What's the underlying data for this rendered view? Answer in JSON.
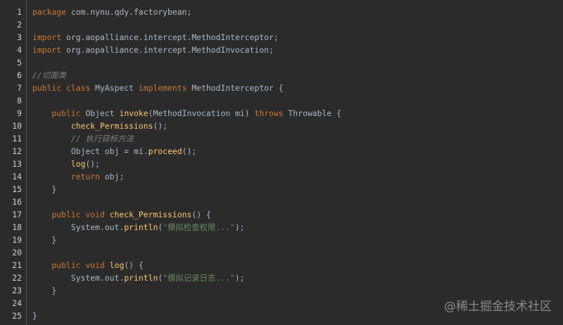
{
  "watermark": "@稀土掘金技术社区",
  "lines": [
    {
      "n": "1",
      "tokens": [
        {
          "c": "kw",
          "t": "package"
        },
        {
          "c": "plain",
          "t": " com.nynu.qdy.factorybean;"
        }
      ]
    },
    {
      "n": "2",
      "tokens": []
    },
    {
      "n": "3",
      "tokens": [
        {
          "c": "kw",
          "t": "import"
        },
        {
          "c": "plain",
          "t": " org.aopalliance.intercept.MethodInterceptor;"
        }
      ]
    },
    {
      "n": "4",
      "tokens": [
        {
          "c": "kw",
          "t": "import"
        },
        {
          "c": "plain",
          "t": " org.aopalliance.intercept.MethodInvocation;"
        }
      ]
    },
    {
      "n": "5",
      "tokens": []
    },
    {
      "n": "6",
      "tokens": [
        {
          "c": "cm-gray",
          "t": "//切面类"
        }
      ]
    },
    {
      "n": "7",
      "tokens": [
        {
          "c": "kw",
          "t": "public"
        },
        {
          "c": "plain",
          "t": " "
        },
        {
          "c": "kw",
          "t": "class"
        },
        {
          "c": "plain",
          "t": " MyAspect "
        },
        {
          "c": "kw",
          "t": "implements"
        },
        {
          "c": "plain",
          "t": " MethodInterceptor {"
        }
      ]
    },
    {
      "n": "8",
      "tokens": []
    },
    {
      "n": "9",
      "tokens": [
        {
          "c": "plain",
          "t": "    "
        },
        {
          "c": "kw",
          "t": "public"
        },
        {
          "c": "plain",
          "t": " Object "
        },
        {
          "c": "fn",
          "t": "invoke"
        },
        {
          "c": "plain",
          "t": "(MethodInvocation mi) "
        },
        {
          "c": "kw",
          "t": "throws"
        },
        {
          "c": "plain",
          "t": " Throwable {"
        }
      ]
    },
    {
      "n": "10",
      "tokens": [
        {
          "c": "plain",
          "t": "        "
        },
        {
          "c": "fn",
          "t": "check_Permissions"
        },
        {
          "c": "plain",
          "t": "();"
        }
      ]
    },
    {
      "n": "11",
      "tokens": [
        {
          "c": "plain",
          "t": "        "
        },
        {
          "c": "cm-gray",
          "t": "// 执行目标方法"
        }
      ]
    },
    {
      "n": "12",
      "tokens": [
        {
          "c": "plain",
          "t": "        Object obj = mi."
        },
        {
          "c": "fn",
          "t": "proceed"
        },
        {
          "c": "plain",
          "t": "();"
        }
      ]
    },
    {
      "n": "13",
      "tokens": [
        {
          "c": "plain",
          "t": "        "
        },
        {
          "c": "fn",
          "t": "log"
        },
        {
          "c": "plain",
          "t": "();"
        }
      ]
    },
    {
      "n": "14",
      "tokens": [
        {
          "c": "plain",
          "t": "        "
        },
        {
          "c": "kw",
          "t": "return"
        },
        {
          "c": "plain",
          "t": " obj;"
        }
      ]
    },
    {
      "n": "15",
      "tokens": [
        {
          "c": "plain",
          "t": "    }"
        }
      ]
    },
    {
      "n": "16",
      "tokens": []
    },
    {
      "n": "17",
      "tokens": [
        {
          "c": "plain",
          "t": "    "
        },
        {
          "c": "kw",
          "t": "public"
        },
        {
          "c": "plain",
          "t": " "
        },
        {
          "c": "kw",
          "t": "void"
        },
        {
          "c": "plain",
          "t": " "
        },
        {
          "c": "fn",
          "t": "check_Permissions"
        },
        {
          "c": "plain",
          "t": "() {"
        }
      ]
    },
    {
      "n": "18",
      "tokens": [
        {
          "c": "plain",
          "t": "        System.out."
        },
        {
          "c": "fn",
          "t": "println"
        },
        {
          "c": "plain",
          "t": "("
        },
        {
          "c": "str",
          "t": "\"模拟检查权限...\""
        },
        {
          "c": "plain",
          "t": ");"
        }
      ]
    },
    {
      "n": "19",
      "tokens": [
        {
          "c": "plain",
          "t": "    }"
        }
      ]
    },
    {
      "n": "20",
      "tokens": []
    },
    {
      "n": "21",
      "tokens": [
        {
          "c": "plain",
          "t": "    "
        },
        {
          "c": "kw",
          "t": "public"
        },
        {
          "c": "plain",
          "t": " "
        },
        {
          "c": "kw",
          "t": "void"
        },
        {
          "c": "plain",
          "t": " "
        },
        {
          "c": "fn",
          "t": "log"
        },
        {
          "c": "plain",
          "t": "() {"
        }
      ]
    },
    {
      "n": "22",
      "tokens": [
        {
          "c": "plain",
          "t": "        System.out."
        },
        {
          "c": "fn",
          "t": "println"
        },
        {
          "c": "plain",
          "t": "("
        },
        {
          "c": "str",
          "t": "\"模拟记录日志...\""
        },
        {
          "c": "plain",
          "t": ");"
        }
      ]
    },
    {
      "n": "23",
      "tokens": [
        {
          "c": "plain",
          "t": "    }"
        }
      ]
    },
    {
      "n": "24",
      "tokens": []
    },
    {
      "n": "25",
      "tokens": [
        {
          "c": "plain",
          "t": "}"
        }
      ]
    }
  ]
}
